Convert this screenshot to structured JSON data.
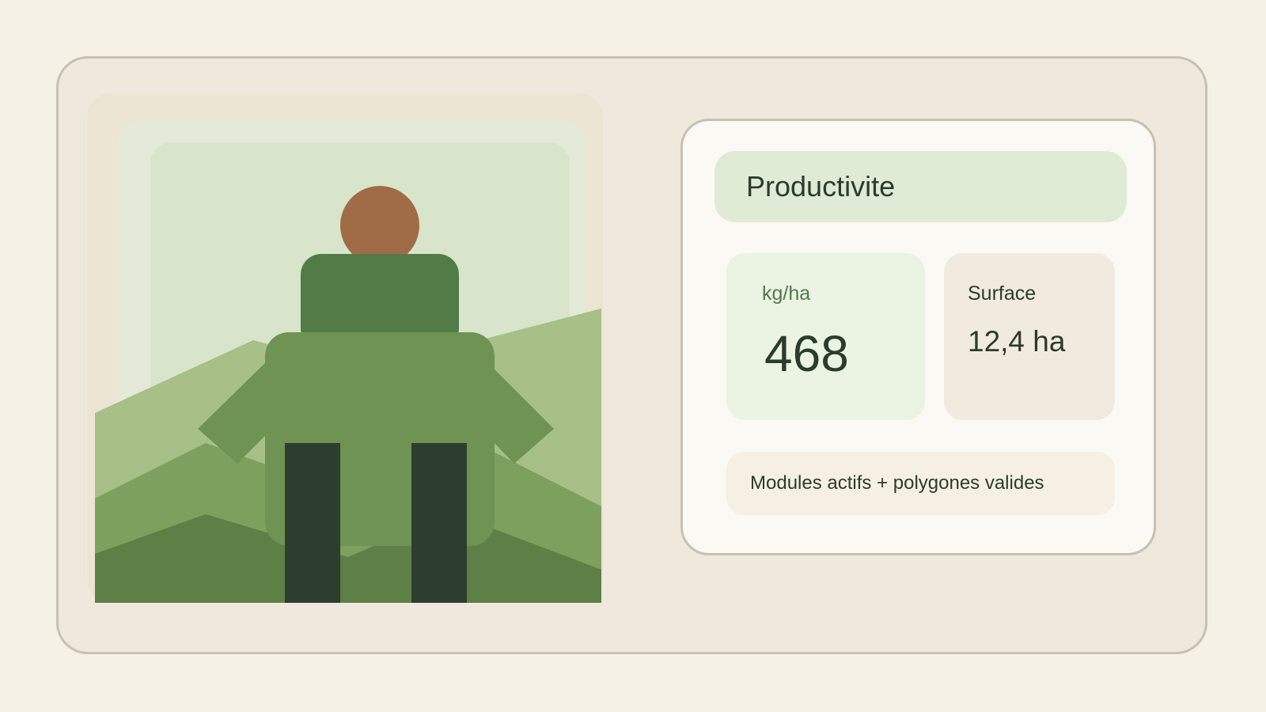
{
  "card": {
    "title": "Productivite",
    "stats": {
      "yield": {
        "label": "kg/ha",
        "value": "468"
      },
      "surface": {
        "label": "Surface",
        "value": "12,4 ha"
      }
    },
    "note": "Modules actifs + polygones valides"
  },
  "illustration": {
    "subject": "farmer-figure",
    "colors": {
      "sky": "#d8e5ca",
      "hill_light": "#a6c087",
      "hill_mid": "#7ea05f",
      "hill_dark": "#5e8046",
      "skin": "#a06c48",
      "shirt_dark": "#517b47",
      "shirt_light": "#6e9352",
      "pants": "#2c3e2d"
    }
  },
  "theme": {
    "background": "#f5f1e6",
    "card": "#efe8dc",
    "panel": "#fbf9f4",
    "accent_green": "#e0ebd6",
    "text": "#2b3c2c",
    "label_green": "#53794a"
  }
}
